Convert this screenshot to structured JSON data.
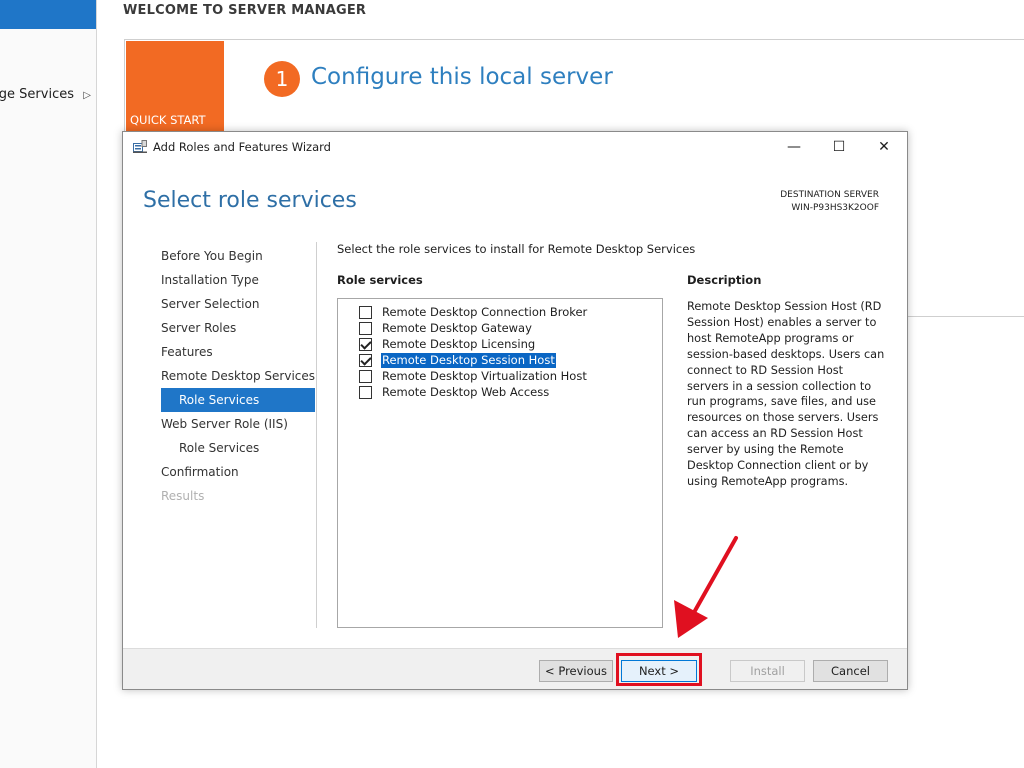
{
  "server_manager": {
    "sidebar_item": "age Services",
    "welcome_title": "WELCOME TO SERVER MANAGER",
    "quick_start_label": "QUICK START",
    "step_number": "1",
    "step_title": "Configure this local server"
  },
  "wizard": {
    "window_title": "Add Roles and Features Wizard",
    "window_controls": {
      "minimize": "—",
      "maximize": "☐",
      "close": "✕"
    },
    "page_title": "Select role services",
    "destination_label": "DESTINATION SERVER",
    "destination_server": "WIN-P93HS3K2OOF",
    "nav": [
      {
        "label": "Before You Begin",
        "sub": false,
        "active": false,
        "disabled": false
      },
      {
        "label": "Installation Type",
        "sub": false,
        "active": false,
        "disabled": false
      },
      {
        "label": "Server Selection",
        "sub": false,
        "active": false,
        "disabled": false
      },
      {
        "label": "Server Roles",
        "sub": false,
        "active": false,
        "disabled": false
      },
      {
        "label": "Features",
        "sub": false,
        "active": false,
        "disabled": false
      },
      {
        "label": "Remote Desktop Services",
        "sub": false,
        "active": false,
        "disabled": false
      },
      {
        "label": "Role Services",
        "sub": true,
        "active": true,
        "disabled": false
      },
      {
        "label": "Web Server Role (IIS)",
        "sub": false,
        "active": false,
        "disabled": false
      },
      {
        "label": "Role Services",
        "sub": true,
        "active": false,
        "disabled": false
      },
      {
        "label": "Confirmation",
        "sub": false,
        "active": false,
        "disabled": false
      },
      {
        "label": "Results",
        "sub": false,
        "active": false,
        "disabled": true
      }
    ],
    "instruction": "Select the role services to install for Remote Desktop Services",
    "role_services_label": "Role services",
    "role_services": [
      {
        "label": "Remote Desktop Connection Broker",
        "checked": false,
        "selected": false
      },
      {
        "label": "Remote Desktop Gateway",
        "checked": false,
        "selected": false
      },
      {
        "label": "Remote Desktop Licensing",
        "checked": true,
        "selected": false
      },
      {
        "label": "Remote Desktop Session Host",
        "checked": true,
        "selected": true
      },
      {
        "label": "Remote Desktop Virtualization Host",
        "checked": false,
        "selected": false
      },
      {
        "label": "Remote Desktop Web Access",
        "checked": false,
        "selected": false
      }
    ],
    "description_label": "Description",
    "description_text": "Remote Desktop Session Host (RD Session Host) enables a server to host RemoteApp programs or session-based desktops. Users can connect to RD Session Host servers in a session collection to run programs, save files, and use resources on those servers. Users can access an RD Session Host server by using the Remote Desktop Connection client or by using RemoteApp programs.",
    "buttons": {
      "previous": "< Previous",
      "next": "Next >",
      "install": "Install",
      "cancel": "Cancel"
    }
  },
  "colors": {
    "accent_blue": "#1f76c8",
    "quick_start_orange": "#f26a23",
    "title_blue": "#2e6fa6",
    "annotation_red": "#e01020"
  }
}
